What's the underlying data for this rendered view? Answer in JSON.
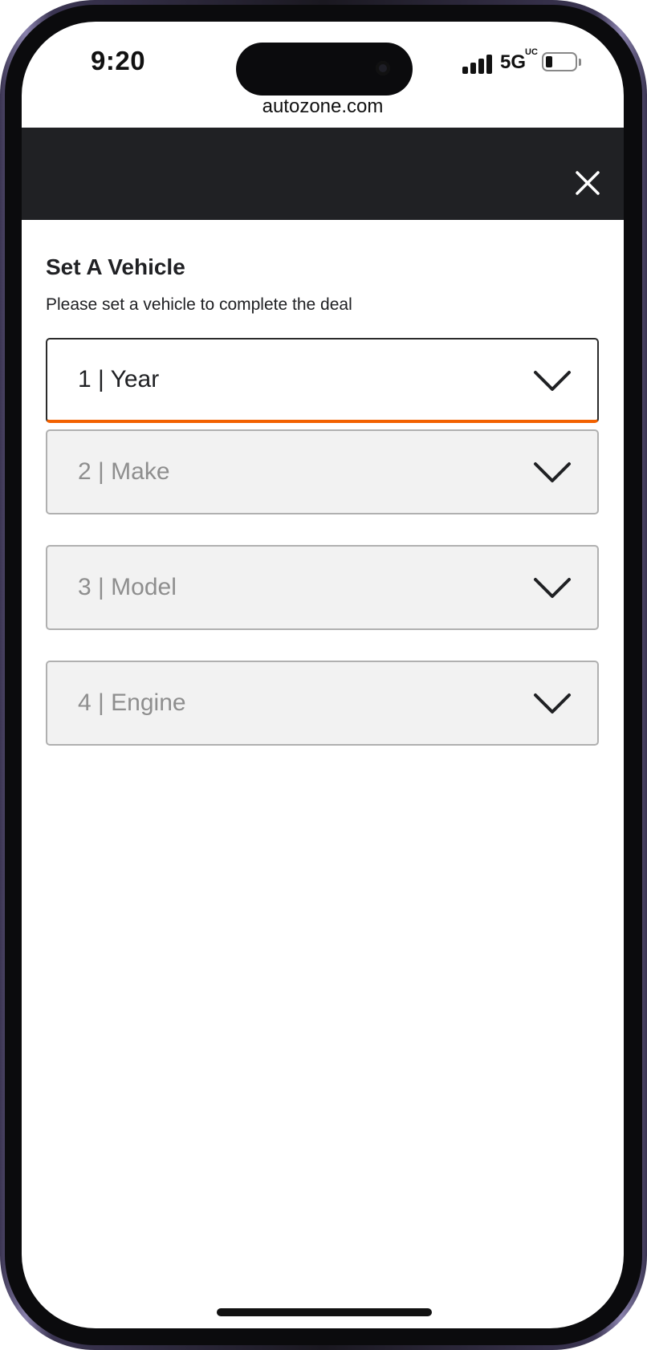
{
  "status_bar": {
    "time": "9:20",
    "network": "5G",
    "network_badge": "UC",
    "battery_icon": "battery-low-icon"
  },
  "browser": {
    "url": "autozone.com"
  },
  "modal": {
    "close_icon": "close-icon",
    "title": "Set A Vehicle",
    "subtitle": "Please set a vehicle to complete the deal",
    "selects": [
      {
        "label": "1 | Year",
        "state": "active"
      },
      {
        "label": "2 | Make",
        "state": "disabled"
      },
      {
        "label": "3 | Model",
        "state": "disabled"
      },
      {
        "label": "4 | Engine",
        "state": "disabled"
      }
    ]
  },
  "colors": {
    "header_bg": "#202124",
    "accent": "#f26100",
    "disabled_bg": "#f2f2f2"
  }
}
